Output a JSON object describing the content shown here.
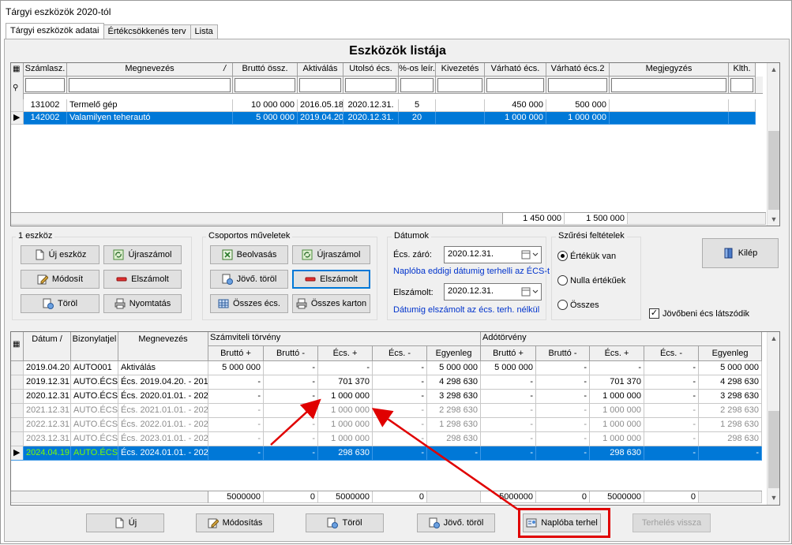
{
  "window": {
    "title": "Tárgyi eszközök 2020-tól"
  },
  "tabs": [
    {
      "label": "Tárgyi eszközök adatai",
      "active": true
    },
    {
      "label": "Értékcsökkenés terv",
      "active": false
    },
    {
      "label": "Lista",
      "active": false
    }
  ],
  "list_title": "Eszközök listája",
  "top_grid": {
    "columns": [
      "Számlasz.",
      "Megnevezés",
      "Bruttó össz.",
      "Aktiválás",
      "Utolsó écs.",
      "%-os leír.",
      "Kivezetés",
      "Várható écs.",
      "Várható écs.2",
      "Megjegyzés",
      "Klth."
    ],
    "sort_mark": "/",
    "rows": [
      {
        "cells": [
          "131002",
          "Termelő gép",
          "10 000 000",
          "2016.05.18.",
          "2020.12.31.",
          "5",
          "",
          "450 000",
          "500 000",
          "",
          ""
        ],
        "selected": false
      },
      {
        "cells": [
          "142002",
          "Valamilyen teherautó",
          "5 000 000",
          "2019.04.20.",
          "2020.12.31.",
          "20",
          "",
          "1 000 000",
          "1 000 000",
          "",
          ""
        ],
        "selected": true
      }
    ],
    "totals": {
      "varhato_ecs": "1 450 000",
      "varhato_ecs2": "1 500 000"
    }
  },
  "group_one": {
    "label": "1 eszköz",
    "buttons": {
      "new": "Új eszköz",
      "recalc": "Újraszámol",
      "modify": "Módosít",
      "settled": "Elszámolt",
      "delete": "Töröl",
      "print": "Nyomtatás"
    }
  },
  "group_multi": {
    "label": "Csoportos műveletek",
    "buttons": {
      "read": "Beolvasás",
      "recalc": "Újraszámol",
      "future_delete": "Jövő. töröl",
      "settled": "Elszámolt",
      "all_ecs": "Összes écs.",
      "all_cards": "Összes karton"
    }
  },
  "dates": {
    "label": "Dátumok",
    "ecs_zaro_label": "Écs. záró:",
    "ecs_zaro_value": "2020.12.31.",
    "ecs_note": "Naplóba eddigi dátumig terhelli az ÉCS-t",
    "elszamolt_label": "Elszámolt:",
    "elszamolt_value": "2020.12.31.",
    "elszamolt_note": "Dátumig elszámolt az écs. terh. nélkül"
  },
  "filters": {
    "label": "Szűrési feltételek",
    "options": [
      {
        "label": "Értékük van",
        "checked": true
      },
      {
        "label": "Nulla értékűek",
        "checked": false
      },
      {
        "label": "Összes",
        "checked": false
      }
    ]
  },
  "exit_button": "Kilép",
  "future_checkbox": {
    "label": "Jövőbeni écs látszódik",
    "checked": true
  },
  "bottom_grid": {
    "col_headers": {
      "date": "Dátum",
      "doc": "Bizonylatjel",
      "name": "Megnevezés"
    },
    "group_headers": {
      "acct": "Számviteli törvény",
      "tax": "Adótörvény"
    },
    "sub_headers": [
      "Bruttó +",
      "Bruttó -",
      "Écs. +",
      "Écs. -",
      "Egyenleg"
    ],
    "rows": [
      {
        "cells": [
          "2019.04.20.",
          "AUTO001",
          "Aktiválás",
          "5 000 000",
          "-",
          "-",
          "-",
          "5 000 000",
          "5 000 000",
          "-",
          "-",
          "-",
          "5 000 000"
        ],
        "style": "normal"
      },
      {
        "cells": [
          "2019.12.31.",
          "AUTO.ÉCS",
          "Écs. 2019.04.20. - 201",
          "-",
          "-",
          "701 370",
          "-",
          "4 298 630",
          "-",
          "-",
          "701 370",
          "-",
          "4 298 630"
        ],
        "style": "normal"
      },
      {
        "cells": [
          "2020.12.31.",
          "AUTO.ÉCS",
          "Écs. 2020.01.01. - 202",
          "-",
          "-",
          "1 000 000",
          "-",
          "3 298 630",
          "-",
          "-",
          "1 000 000",
          "-",
          "3 298 630"
        ],
        "style": "normal"
      },
      {
        "cells": [
          "2021.12.31.",
          "AUTO.ÉCS",
          "Écs. 2021.01.01. - 202",
          "-",
          "-",
          "1 000 000",
          "-",
          "2 298 630",
          "-",
          "-",
          "1 000 000",
          "-",
          "2 298 630"
        ],
        "style": "gray"
      },
      {
        "cells": [
          "2022.12.31.",
          "AUTO.ÉCS",
          "Écs. 2022.01.01. - 202",
          "-",
          "-",
          "1 000 000",
          "-",
          "1 298 630",
          "-",
          "-",
          "1 000 000",
          "-",
          "1 298 630"
        ],
        "style": "gray"
      },
      {
        "cells": [
          "2023.12.31.",
          "AUTO.ÉCS",
          "Écs. 2023.01.01. - 202",
          "-",
          "-",
          "1 000 000",
          "-",
          "298 630",
          "-",
          "-",
          "1 000 000",
          "-",
          "298 630"
        ],
        "style": "gray"
      },
      {
        "cells": [
          "2024.04.19.",
          "AUTO.ÉCS",
          "Écs. 2024.01.01. - 202",
          "-",
          "-",
          "298 630",
          "-",
          "-",
          "-",
          "-",
          "298 630",
          "-",
          "-"
        ],
        "style": "selected"
      }
    ],
    "totals": [
      "5000000",
      "0",
      "5000000",
      "0",
      "",
      "5000000",
      "0",
      "5000000",
      "0",
      ""
    ]
  },
  "bottom_buttons": {
    "new": "Új",
    "modify": "Módosítás",
    "delete": "Töröl",
    "future_delete": "Jövő. töröl",
    "journal": "Naplóba terhel",
    "undo": "Terhelés vissza"
  },
  "colors": {
    "selection": "#0078d7",
    "annotation": "#e00000",
    "future_row_text": "#8c8c8c",
    "selected_date_text": "#7cfc00"
  }
}
